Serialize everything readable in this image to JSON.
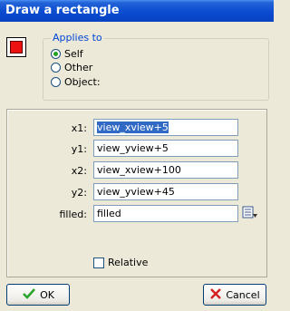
{
  "window": {
    "title": "Draw a rectangle"
  },
  "applies_to": {
    "legend": "Applies to",
    "options": [
      {
        "label": "Self",
        "selected": true
      },
      {
        "label": "Other",
        "selected": false
      },
      {
        "label": "Object:",
        "selected": false
      }
    ]
  },
  "fields": [
    {
      "label": "x1:",
      "value": "view_xview+5"
    },
    {
      "label": "y1:",
      "value": "view_yview+5"
    },
    {
      "label": "x2:",
      "value": "view_xview+100"
    },
    {
      "label": "y2:",
      "value": "view_yview+45"
    },
    {
      "label": "filled:",
      "value": "filled"
    }
  ],
  "relative": {
    "label": "Relative",
    "checked": false
  },
  "buttons": {
    "ok_label": "OK",
    "cancel_label": "Cancel"
  },
  "colors": {
    "title_bar": "#0A4BD0",
    "action_icon": "#E11111",
    "selected_text_bg": "#316AC5",
    "ok_check": "#2BA52B",
    "cancel_x": "#D42020"
  }
}
